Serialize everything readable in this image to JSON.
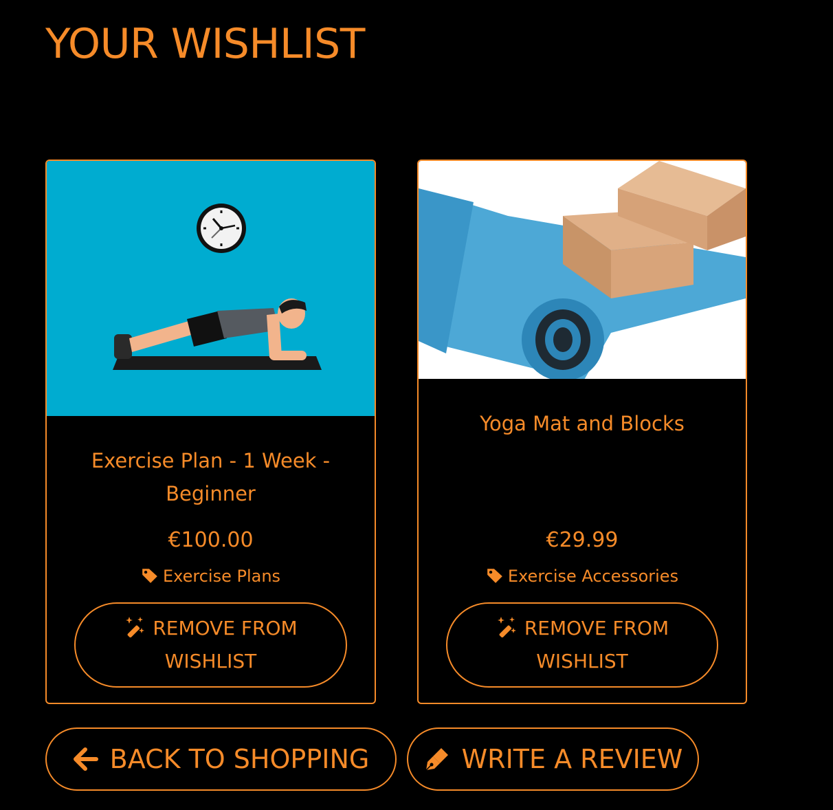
{
  "page": {
    "title": "YOUR WISHLIST"
  },
  "colors": {
    "accent": "#f68b29",
    "background": "#000000",
    "card1_image_bg": "#00acd0"
  },
  "wishlist": {
    "items": [
      {
        "title": "Exercise Plan - 1 Week - Beginner",
        "price": "€100.00",
        "category": "Exercise Plans",
        "image_icon": "plank-exercise-illustration",
        "remove_label_line1": "REMOVE FROM",
        "remove_label_line2": "WISHLIST"
      },
      {
        "title": "Yoga Mat and Blocks",
        "price": "€29.99",
        "category": "Exercise Accessories",
        "image_icon": "yoga-mat-blocks-photo",
        "remove_label_line1": "REMOVE FROM",
        "remove_label_line2": "WISHLIST"
      }
    ]
  },
  "actions": {
    "back_label": "BACK TO SHOPPING",
    "review_label": "WRITE A REVIEW"
  },
  "icons": {
    "tag": "tag-icon",
    "magic": "magic-wand-icon",
    "back": "arrow-left-icon",
    "review": "pen-nib-icon"
  }
}
